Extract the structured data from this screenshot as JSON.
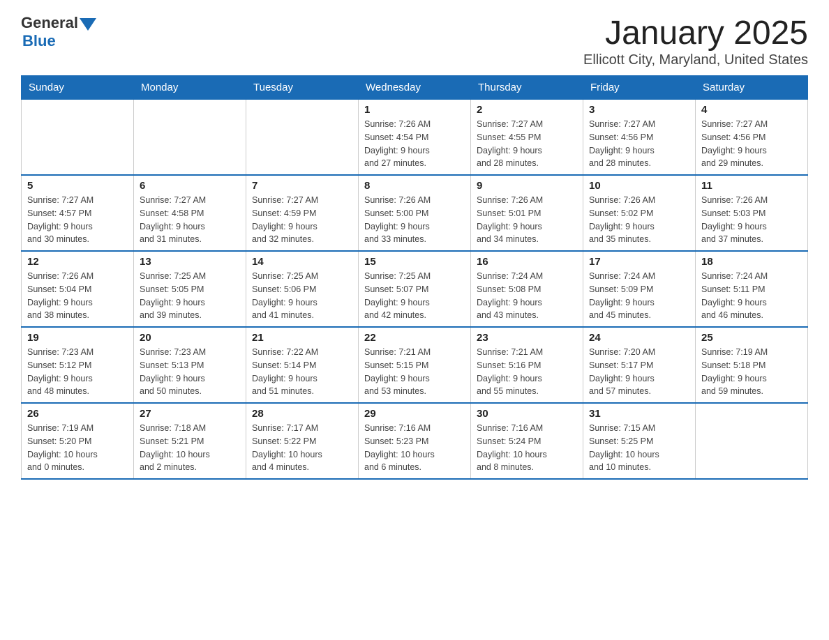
{
  "header": {
    "title": "January 2025",
    "subtitle": "Ellicott City, Maryland, United States",
    "logo": {
      "general": "General",
      "blue": "Blue"
    }
  },
  "days_of_week": [
    "Sunday",
    "Monday",
    "Tuesday",
    "Wednesday",
    "Thursday",
    "Friday",
    "Saturday"
  ],
  "weeks": [
    [
      {
        "day": "",
        "info": ""
      },
      {
        "day": "",
        "info": ""
      },
      {
        "day": "",
        "info": ""
      },
      {
        "day": "1",
        "info": "Sunrise: 7:26 AM\nSunset: 4:54 PM\nDaylight: 9 hours\nand 27 minutes."
      },
      {
        "day": "2",
        "info": "Sunrise: 7:27 AM\nSunset: 4:55 PM\nDaylight: 9 hours\nand 28 minutes."
      },
      {
        "day": "3",
        "info": "Sunrise: 7:27 AM\nSunset: 4:56 PM\nDaylight: 9 hours\nand 28 minutes."
      },
      {
        "day": "4",
        "info": "Sunrise: 7:27 AM\nSunset: 4:56 PM\nDaylight: 9 hours\nand 29 minutes."
      }
    ],
    [
      {
        "day": "5",
        "info": "Sunrise: 7:27 AM\nSunset: 4:57 PM\nDaylight: 9 hours\nand 30 minutes."
      },
      {
        "day": "6",
        "info": "Sunrise: 7:27 AM\nSunset: 4:58 PM\nDaylight: 9 hours\nand 31 minutes."
      },
      {
        "day": "7",
        "info": "Sunrise: 7:27 AM\nSunset: 4:59 PM\nDaylight: 9 hours\nand 32 minutes."
      },
      {
        "day": "8",
        "info": "Sunrise: 7:26 AM\nSunset: 5:00 PM\nDaylight: 9 hours\nand 33 minutes."
      },
      {
        "day": "9",
        "info": "Sunrise: 7:26 AM\nSunset: 5:01 PM\nDaylight: 9 hours\nand 34 minutes."
      },
      {
        "day": "10",
        "info": "Sunrise: 7:26 AM\nSunset: 5:02 PM\nDaylight: 9 hours\nand 35 minutes."
      },
      {
        "day": "11",
        "info": "Sunrise: 7:26 AM\nSunset: 5:03 PM\nDaylight: 9 hours\nand 37 minutes."
      }
    ],
    [
      {
        "day": "12",
        "info": "Sunrise: 7:26 AM\nSunset: 5:04 PM\nDaylight: 9 hours\nand 38 minutes."
      },
      {
        "day": "13",
        "info": "Sunrise: 7:25 AM\nSunset: 5:05 PM\nDaylight: 9 hours\nand 39 minutes."
      },
      {
        "day": "14",
        "info": "Sunrise: 7:25 AM\nSunset: 5:06 PM\nDaylight: 9 hours\nand 41 minutes."
      },
      {
        "day": "15",
        "info": "Sunrise: 7:25 AM\nSunset: 5:07 PM\nDaylight: 9 hours\nand 42 minutes."
      },
      {
        "day": "16",
        "info": "Sunrise: 7:24 AM\nSunset: 5:08 PM\nDaylight: 9 hours\nand 43 minutes."
      },
      {
        "day": "17",
        "info": "Sunrise: 7:24 AM\nSunset: 5:09 PM\nDaylight: 9 hours\nand 45 minutes."
      },
      {
        "day": "18",
        "info": "Sunrise: 7:24 AM\nSunset: 5:11 PM\nDaylight: 9 hours\nand 46 minutes."
      }
    ],
    [
      {
        "day": "19",
        "info": "Sunrise: 7:23 AM\nSunset: 5:12 PM\nDaylight: 9 hours\nand 48 minutes."
      },
      {
        "day": "20",
        "info": "Sunrise: 7:23 AM\nSunset: 5:13 PM\nDaylight: 9 hours\nand 50 minutes."
      },
      {
        "day": "21",
        "info": "Sunrise: 7:22 AM\nSunset: 5:14 PM\nDaylight: 9 hours\nand 51 minutes."
      },
      {
        "day": "22",
        "info": "Sunrise: 7:21 AM\nSunset: 5:15 PM\nDaylight: 9 hours\nand 53 minutes."
      },
      {
        "day": "23",
        "info": "Sunrise: 7:21 AM\nSunset: 5:16 PM\nDaylight: 9 hours\nand 55 minutes."
      },
      {
        "day": "24",
        "info": "Sunrise: 7:20 AM\nSunset: 5:17 PM\nDaylight: 9 hours\nand 57 minutes."
      },
      {
        "day": "25",
        "info": "Sunrise: 7:19 AM\nSunset: 5:18 PM\nDaylight: 9 hours\nand 59 minutes."
      }
    ],
    [
      {
        "day": "26",
        "info": "Sunrise: 7:19 AM\nSunset: 5:20 PM\nDaylight: 10 hours\nand 0 minutes."
      },
      {
        "day": "27",
        "info": "Sunrise: 7:18 AM\nSunset: 5:21 PM\nDaylight: 10 hours\nand 2 minutes."
      },
      {
        "day": "28",
        "info": "Sunrise: 7:17 AM\nSunset: 5:22 PM\nDaylight: 10 hours\nand 4 minutes."
      },
      {
        "day": "29",
        "info": "Sunrise: 7:16 AM\nSunset: 5:23 PM\nDaylight: 10 hours\nand 6 minutes."
      },
      {
        "day": "30",
        "info": "Sunrise: 7:16 AM\nSunset: 5:24 PM\nDaylight: 10 hours\nand 8 minutes."
      },
      {
        "day": "31",
        "info": "Sunrise: 7:15 AM\nSunset: 5:25 PM\nDaylight: 10 hours\nand 10 minutes."
      },
      {
        "day": "",
        "info": ""
      }
    ]
  ]
}
